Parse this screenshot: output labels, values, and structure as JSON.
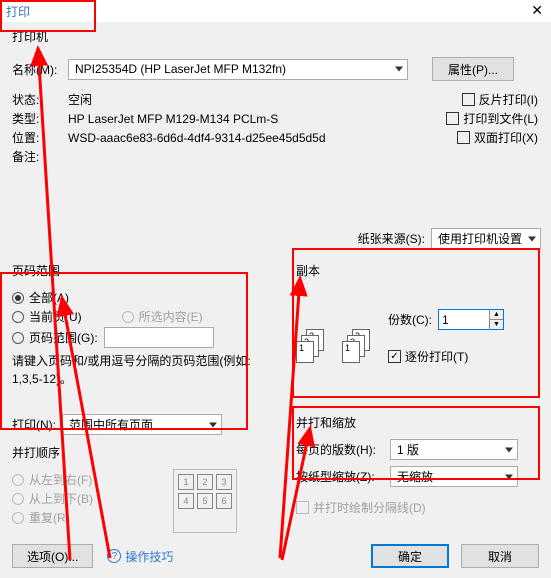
{
  "title": "打印",
  "printer": {
    "legend": "打印机",
    "name_label": "名称(M):",
    "name_value": "NPI25354D (HP LaserJet MFP M132fn)",
    "properties_btn": "属性(P)...",
    "status_label": "状态:",
    "status_value": "空闲",
    "type_label": "类型:",
    "type_value": "HP LaserJet MFP M129-M134 PCLm-S",
    "where_label": "位置:",
    "where_value": "WSD-aaac6e83-6d6d-4df4-9314-d25ee45d5d5d",
    "comment_label": "备注:",
    "flip": "反片打印(I)",
    "to_file": "打印到文件(L)",
    "duplex": "双面打印(X)"
  },
  "paper": {
    "source_label": "纸张来源(S):",
    "source_value": "使用打印机设置"
  },
  "range": {
    "legend": "页码范围",
    "all": "全部(A)",
    "current": "当前页(U)",
    "selection": "所选内容(E)",
    "pages": "页码范围(G):",
    "hint": "请键入页码和/或用逗号分隔的页码范围(例如: 1,3,5-12)。",
    "print_label": "打印(N):",
    "print_value": "范围中所有页面"
  },
  "copies": {
    "legend": "副本",
    "count_label": "份数(C):",
    "count_value": "1",
    "collate": "逐份打印(T)"
  },
  "order": {
    "legend": "并打顺序",
    "lr": "从左到右(F)",
    "tb": "从上到下(B)",
    "repeat": "重复(R)"
  },
  "zoom": {
    "legend": "并打和缩放",
    "per_sheet_label": "每页的版数(H):",
    "per_sheet_value": "1 版",
    "scale_label": "按纸型缩放(Z):",
    "scale_value": "无缩放",
    "draw_lines": "并打时绘制分隔线(D)"
  },
  "footer": {
    "options": "选项(O)...",
    "tips": "操作技巧",
    "ok": "确定",
    "cancel": "取消"
  }
}
